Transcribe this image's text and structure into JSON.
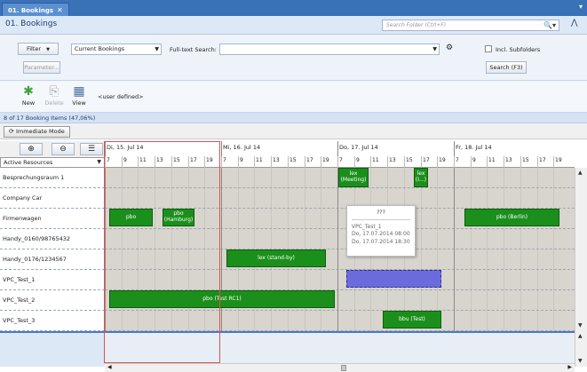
{
  "tab": {
    "label": "01. Bookings",
    "close": "✕",
    "menu": "▾"
  },
  "header": {
    "title": "01. Bookings",
    "search_placeholder": "Search Folder (Ctrl+F)",
    "search_icon": "🔍▾",
    "collapse": "⋀"
  },
  "filter": {
    "filter_button": "Filter",
    "filter_arrow": "▼",
    "view_value": "Current Bookings",
    "fulltext_label": "Full-text Search:",
    "fulltext_value": "",
    "parameter_button": "Parameter...",
    "incl_subfolders_label": "Incl. Subfolders",
    "search_button": "Search (F3)"
  },
  "ribbon": {
    "new_label": "New",
    "delete_label": "Delete",
    "view_label": "View",
    "user_defined": "<user defined>"
  },
  "count_text": "8 of 17 Booking Items (47,06%)",
  "immediate_mode": "Immediate Mode",
  "resources_header": "Active Resources",
  "resources": [
    "Besprechungsraum 1",
    "Company Car",
    "Firmenwagen",
    "Handy_0160/98765432",
    "Handy_0176/1234567",
    "VPC_Test_1",
    "VPC_Test_2",
    "VPC_Test_3"
  ],
  "days": [
    "Di, 15. Jul 14",
    "Mi, 16. Jul 14",
    "Do, 17. Jul 14",
    "Fr, 18. Jul 14"
  ],
  "hours": [
    "7",
    "9",
    "11",
    "13",
    "15",
    "17",
    "19"
  ],
  "bookings": [
    {
      "label": "lex\n(Meeting)"
    },
    {
      "label": "lex\n(I...)"
    },
    {
      "label": "pbo"
    },
    {
      "label": "pbo\n(Hamburg)"
    },
    {
      "label": "pbo (Berlin)"
    },
    {
      "label": "lex (stand-by)"
    },
    {
      "label": ""
    },
    {
      "label": "pbo (Test RC1)"
    },
    {
      "label": "bbu (Test)"
    }
  ],
  "tooltip": {
    "title": "???",
    "line1": "VPC_Test_1",
    "line2": "Do, 17.07.2014 08:00",
    "line3": "Do, 17.07.2014 18:30"
  }
}
